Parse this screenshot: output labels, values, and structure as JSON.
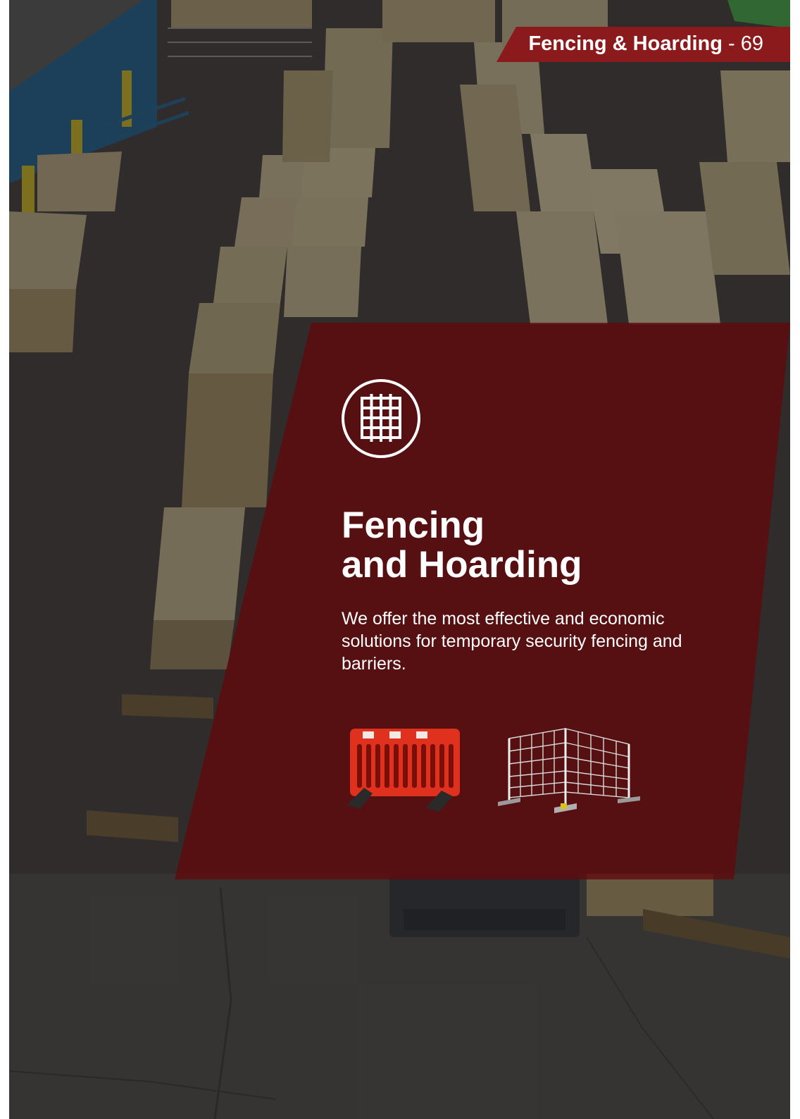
{
  "header": {
    "title": "Fencing & Hoarding",
    "separator": " - ",
    "page_number": "69"
  },
  "section": {
    "title_line1": "Fencing",
    "title_line2": "and Hoarding",
    "description": "We offer the most effective and economic solutions for temporary security fencing and barriers."
  },
  "colors": {
    "brand_red": "#8b1a1c",
    "panel_overlay": "#600a0c",
    "barrier_red": "#e0301e",
    "text": "#ffffff"
  },
  "icons": [
    "fence-icon"
  ],
  "images": [
    "warehouse-lumber-yard-photo",
    "plastic-road-barrier-image",
    "mesh-fence-panel-image"
  ]
}
